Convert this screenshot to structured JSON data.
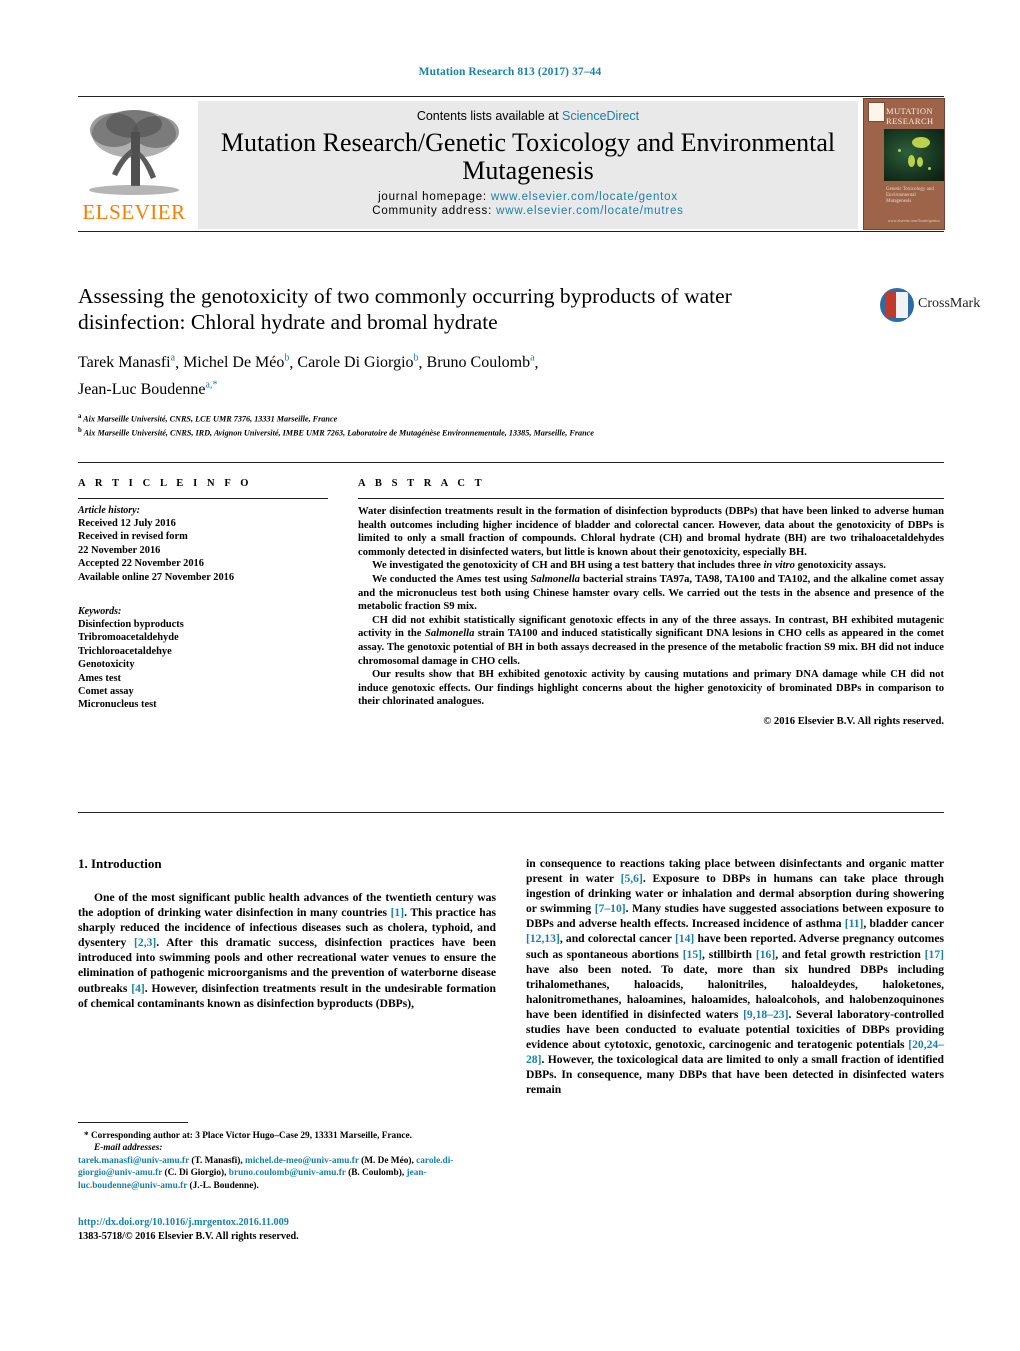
{
  "running_head": "Mutation Research 813 (2017) 37–44",
  "masthead": {
    "contents_prefix": "Contents lists available at ",
    "sciencedirect": "ScienceDirect",
    "journal_title": "Mutation Research/Genetic Toxicology and Environmental Mutagenesis",
    "homepage_label": "journal homepage: ",
    "homepage_url": "www.elsevier.com/locate/gentox",
    "community_label": "Community address: ",
    "community_url": "www.elsevier.com/locate/mutres",
    "publisher_logo": "ELSEVIER",
    "cover": {
      "title": "MUTATION RESEARCH",
      "subtitle": "Genetic Toxicology and Environmental Mutagenesis",
      "footer": "www.elsevier.com/locate/gentox",
      "bg_color": "#9d6449"
    }
  },
  "article": {
    "title": "Assessing the genotoxicity of two commonly occurring byproducts of water disinfection: Chloral hydrate and bromal hydrate",
    "authors": [
      {
        "name": "Tarek Manasfi",
        "sup": "a"
      },
      {
        "name": "Michel De Méo",
        "sup": "b"
      },
      {
        "name": "Carole Di Giorgio",
        "sup": "b"
      },
      {
        "name": "Bruno Coulomb",
        "sup": "a"
      },
      {
        "name": "Jean-Luc Boudenne",
        "sup": "a,*"
      }
    ],
    "affiliations": [
      {
        "marker": "a",
        "text": "Aix Marseille Université, CNRS, LCE UMR 7376, 13331 Marseille, France"
      },
      {
        "marker": "b",
        "text": "Aix Marseille Université, CNRS, IRD, Avignon Université, IMBE UMR 7263, Laboratoire de Mutagénèse Environnementale, 13385, Marseille, France"
      }
    ],
    "crossmark_label": "CrossMark"
  },
  "article_info": {
    "heading": "A R T I C L E   I N F O",
    "history_label": "Article history:",
    "history": [
      "Received 12 July 2016",
      "Received in revised form",
      "22 November 2016",
      "Accepted 22 November 2016",
      "Available online 27 November 2016"
    ],
    "keywords_label": "Keywords:",
    "keywords": [
      "Disinfection byproducts",
      "Tribromoacetaldehyde",
      "Trichloroacetaldehye",
      "Genotoxicity",
      "Ames test",
      "Comet assay",
      "Micronucleus test"
    ]
  },
  "abstract": {
    "heading": "A B S T R A C T",
    "paragraphs": [
      "Water disinfection treatments result in the formation of disinfection byproducts (DBPs) that have been linked to adverse human health outcomes including higher incidence of bladder and colorectal cancer. However, data about the genotoxicity of DBPs is limited to only a small fraction of compounds. Chloral hydrate (CH) and bromal hydrate (BH) are two trihaloacetaldehydes commonly detected in disinfected waters, but little is known about their genotoxicity, especially BH.",
      "We investigated the genotoxicity of CH and BH using a test battery that includes three in vitro genotoxicity assays.",
      "We conducted the Ames test using Salmonella bacterial strains TA97a, TA98, TA100 and TA102, and the alkaline comet assay and the micronucleus test both using Chinese hamster ovary cells. We carried out the tests in the absence and presence of the metabolic fraction S9 mix.",
      "CH did not exhibit statistically significant genotoxic effects in any of the three assays. In contrast, BH exhibited mutagenic activity in the Salmonella strain TA100 and induced statistically significant DNA lesions in CHO cells as appeared in the comet assay. The genotoxic potential of BH in both assays decreased in the presence of the metabolic fraction S9 mix. BH did not induce chromosomal damage in CHO cells.",
      "Our results show that BH exhibited genotoxic activity by causing mutations and primary DNA damage while CH did not induce genotoxic effects. Our findings highlight concerns about the higher genotoxicity of brominated DBPs in comparison to their chlorinated analogues."
    ],
    "copyright": "© 2016 Elsevier B.V. All rights reserved."
  },
  "body": {
    "section_heading": "1. Introduction",
    "left_paragraph": "One of the most significant public health advances of the twentieth century was the adoption of drinking water disinfection in many countries [1]. This practice has sharply reduced the incidence of infectious diseases such as cholera, typhoid, and dysentery [2,3]. After this dramatic success, disinfection practices have been introduced into swimming pools and other recreational water venues to ensure the elimination of pathogenic microorganisms and the prevention of waterborne disease outbreaks [4]. However, disinfection treatments result in the undesirable formation of chemical contaminants known as disinfection byproducts (DBPs),",
    "right_paragraph": "in consequence to reactions taking place between disinfectants and organic matter present in water [5,6]. Exposure to DBPs in humans can take place through ingestion of drinking water or inhalation and dermal absorption during showering or swimming [7–10]. Many studies have suggested associations between exposure to DBPs and adverse health effects. Increased incidence of asthma [11], bladder cancer [12,13], and colorectal cancer [14] have been reported. Adverse pregnancy outcomes such as spontaneous abortions [15], stillbirth [16], and fetal growth restriction [17] have also been noted. To date, more than six hundred DBPs including trihalomethanes, haloacids, halonitriles, haloaldeydes, haloketones, halonitromethanes, haloamines, haloamides, haloalcohols, and halobenzoquinones have been identified in disinfected waters [9,18–23]. Several laboratory-controlled studies have been conducted to evaluate potential toxicities of DBPs providing evidence about cytotoxic, genotoxic, carcinogenic and teratogenic potentials [20,24–28]. However, the toxicological data are limited to only a small fraction of identified DBPs. In consequence, many DBPs that have been detected in disinfected waters remain"
  },
  "footnotes": {
    "corresponding": "* Corresponding author at: 3 Place Victor Hugo–Case 29, 13331 Marseille, France.",
    "email_label": "E-mail addresses:",
    "emails": [
      {
        "address": "tarek.manasfi@univ-amu.fr",
        "person": "(T. Manasfi)"
      },
      {
        "address": "michel.de-meo@univ-amu.fr",
        "person": "(M. De Méo)"
      },
      {
        "address": "carole.di-giorgio@univ-amu.fr",
        "person": "(C. Di Giorgio)"
      },
      {
        "address": "bruno.coulomb@univ-amu.fr",
        "person": "(B. Coulomb)"
      },
      {
        "address": "jean-luc.boudenne@univ-amu.fr",
        "person": "(J.-L. Boudenne)"
      }
    ],
    "doi": "http://dx.doi.org/10.1016/j.mrgentox.2016.11.009",
    "issn_line": "1383-5718/© 2016 Elsevier B.V. All rights reserved."
  },
  "colors": {
    "link": "#1a7fa8",
    "elsevier_orange": "#f08000"
  }
}
